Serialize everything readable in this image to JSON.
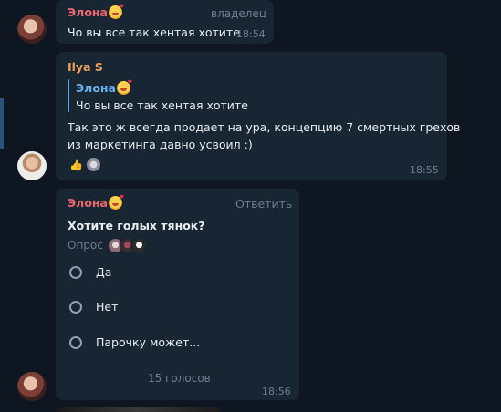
{
  "messages": [
    {
      "sender": "Элона",
      "role_badge": "владелец",
      "text": "Чо вы все так хентая хотите",
      "time": "18:54"
    },
    {
      "sender": "Ilya S",
      "reply_to": {
        "sender": "Элона",
        "text": "Чо вы все так хентая хотите"
      },
      "text_lines": [
        "Так это ж всегда продает на ура, концепцию 7 смертных грехов",
        "из маркетинга давно усвоил :)"
      ],
      "reactions": [
        "👍"
      ],
      "time": "18:55"
    },
    {
      "sender": "Элона",
      "reply_button": "Ответить",
      "poll": {
        "question": "Хотите голых тянок?",
        "type_label": "Опрос",
        "options": [
          "Да",
          "Нет",
          "Парочку может..."
        ],
        "votes_label": "15 голосов"
      },
      "time": "18:56"
    }
  ],
  "colors": {
    "background": "#0e1621",
    "bubble": "#182533",
    "sender_elona": "#ee686f",
    "sender_ilya": "#e8a25a",
    "reply_accent": "#6ab3f3",
    "muted": "#6d7f8f"
  }
}
